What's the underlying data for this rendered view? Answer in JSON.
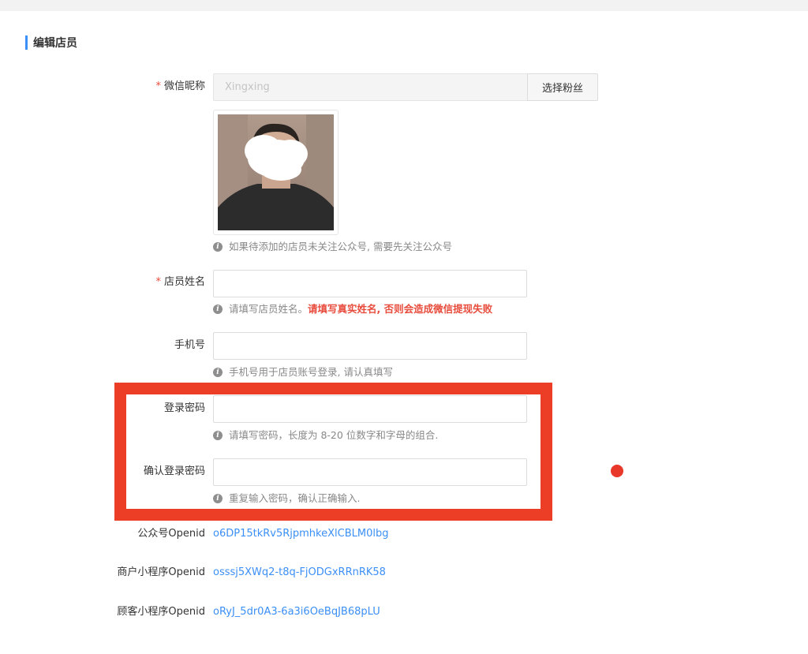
{
  "page": {
    "section_title": "编辑店员"
  },
  "form": {
    "nickname": {
      "label": "微信昵称",
      "required_mark": "*",
      "value": "Xingxing",
      "button_label": "选择粉丝"
    },
    "avatar_hint": "如果待添加的店员未关注公众号, 需要先关注公众号",
    "staff_name": {
      "label": "店员姓名",
      "required_mark": "*",
      "value": "",
      "hint": "请填写店员姓名。",
      "hint_warning": "请填写真实姓名, 否则会造成微信提现失败"
    },
    "phone": {
      "label": "手机号",
      "value": "",
      "hint": "手机号用于店员账号登录, 请认真填写"
    },
    "password": {
      "label": "登录密码",
      "value": "",
      "hint": "请填写密码，长度为 8-20 位数字和字母的组合."
    },
    "confirm_password": {
      "label": "确认登录密码",
      "value": "",
      "hint": "重复输入密码，确认正确输入."
    },
    "openids": [
      {
        "label": "公众号Openid",
        "value": "o6DP15tkRv5RjpmhkeXlCBLM0lbg"
      },
      {
        "label": "商户小程序Openid",
        "value": "osssj5XWq2-t8q-FjODGxRRnRK58"
      },
      {
        "label": "顾客小程序Openid",
        "value": "oRyJ_5dr0A3-6a3i6OeBqJB68pLU"
      }
    ]
  },
  "icons": {
    "info": "info-icon"
  },
  "colors": {
    "accent": "#3b8ff6",
    "required": "#e84c3d",
    "annotation": "#ec3d26"
  }
}
